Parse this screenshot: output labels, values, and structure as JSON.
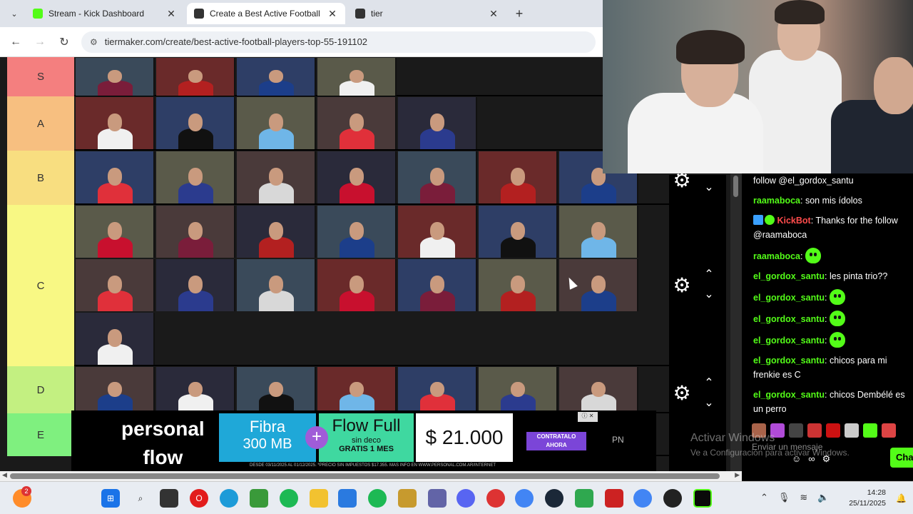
{
  "browser": {
    "tabs": [
      {
        "title": "Stream - Kick Dashboard",
        "color": "#53fc18",
        "active": false
      },
      {
        "title": "Create a Best Active Football Pl",
        "color": "#333333",
        "active": true
      },
      {
        "title": "tier",
        "color": "#333333",
        "active": false
      }
    ],
    "url": "tiermaker.com/create/best-active-football-players-top-55-191102"
  },
  "tiers": [
    {
      "label": "S",
      "color": "#f47f7f"
    },
    {
      "label": "A",
      "color": "#f7bf80"
    },
    {
      "label": "B",
      "color": "#f8de80"
    },
    {
      "label": "C",
      "color": "#f8f884"
    },
    {
      "label": "D",
      "color": "#c3f081"
    },
    {
      "label": "E",
      "color": "#7ff07f"
    }
  ],
  "ad": {
    "brand_line1": "personal",
    "brand_line2": "flow",
    "fibra_line1": "Fibra",
    "fibra_line2": "300 MB",
    "flow_line1": "Flow Full",
    "flow_line2": "sin deco",
    "flow_line3": "GRATIS 1 MES",
    "price": "$ 21.000",
    "cta": "CONTRATALO AHORA",
    "legal": "DESDE 03/11/2025 AL 01/12/2025. *PRECIO SIN IMPUESTOS $17.355. MAS INFO EN WWW.PERSONAL.COM.AR/INTERNET",
    "corner": "PN"
  },
  "chat": {
    "messages": [
      {
        "user": "",
        "text": "follow @el_gordox_santu",
        "type": "plain"
      },
      {
        "user": "raamaboca",
        "text": "son mis ídolos",
        "type": "user"
      },
      {
        "user": "KickBot",
        "text": "Thanks for the follow @raamaboca",
        "type": "bot"
      },
      {
        "user": "raamaboca",
        "text": "",
        "type": "emote"
      },
      {
        "user": "el_gordox_santu",
        "text": "les pinta trio??",
        "type": "user"
      },
      {
        "user": "el_gordox_santu",
        "text": "",
        "type": "emote"
      },
      {
        "user": "el_gordox_santu",
        "text": "",
        "type": "emote"
      },
      {
        "user": "el_gordox_santu",
        "text": "",
        "type": "emote"
      },
      {
        "user": "el_gordox_santu",
        "text": "chicos para mi frenkie es C",
        "type": "user"
      },
      {
        "user": "el_gordox_santu",
        "text": "chicos Dembélé es un perro",
        "type": "user"
      }
    ],
    "input_placeholder": "Enviar un mensaje",
    "send_label": "Cha"
  },
  "watermark": {
    "title": "Activar Windows",
    "subtitle": "Ve a Configuración para activar Windows."
  },
  "taskbar": {
    "notification_count": "2",
    "time": "14:28",
    "date": "25/11/2025"
  }
}
